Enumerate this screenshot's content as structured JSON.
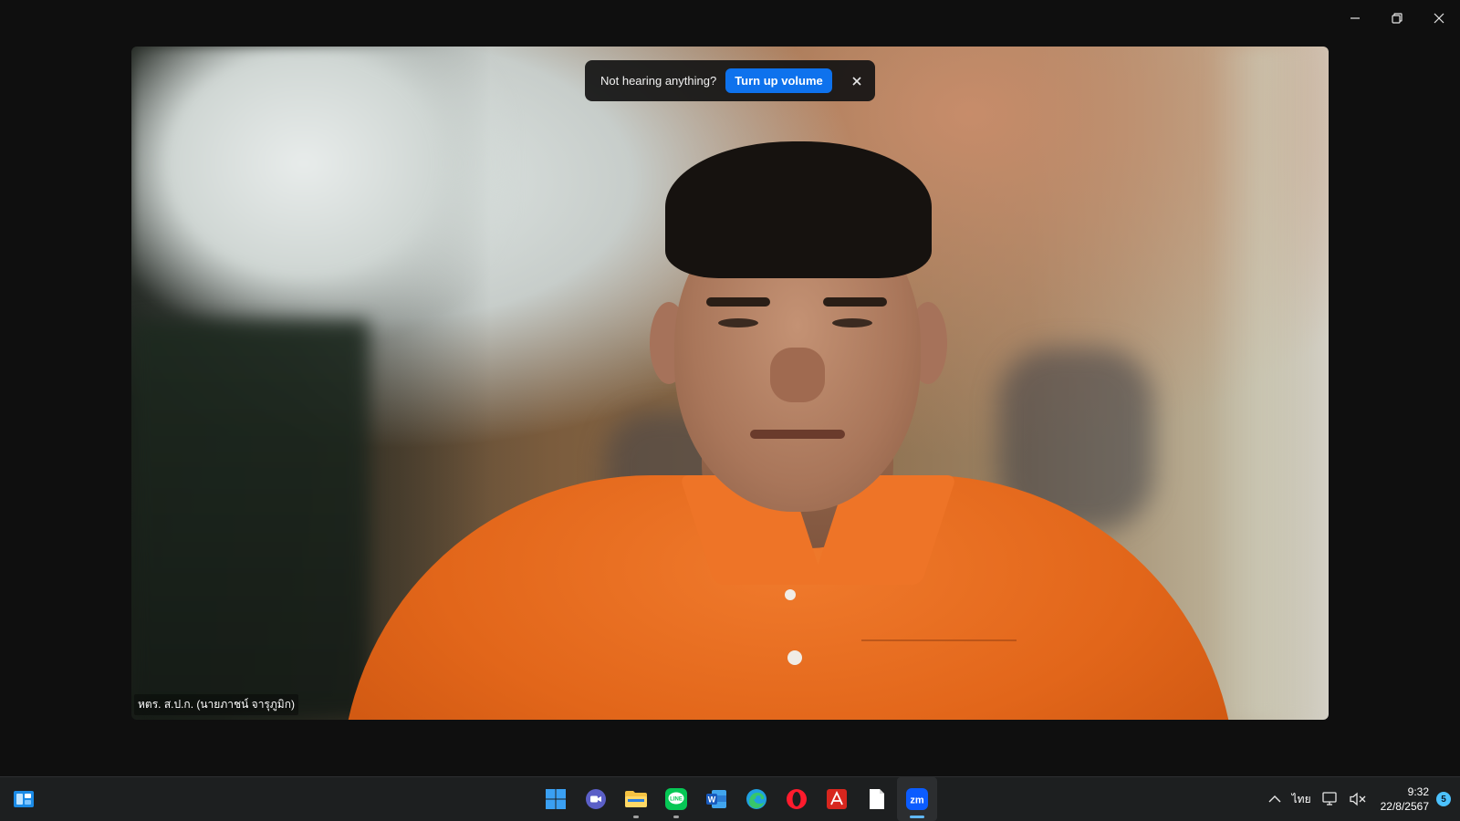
{
  "window": {
    "controls": [
      "minimize",
      "restore",
      "close"
    ]
  },
  "notice": {
    "text": "Not hearing anything?",
    "button_label": "Turn up volume",
    "close_symbol": "×",
    "button_color": "#0e72ed"
  },
  "participant": {
    "name": "หตร. ส.ป.ก. (นายภาชน์ จารุภูมิก)"
  },
  "taskbar": {
    "apps": [
      {
        "name": "start",
        "icon": "windows-start-icon",
        "running": false
      },
      {
        "name": "teams-meet",
        "icon": "video-chat-icon",
        "running": false
      },
      {
        "name": "file-explorer",
        "icon": "folder-icon",
        "running": true
      },
      {
        "name": "line",
        "icon": "line-chat-icon",
        "running": true
      },
      {
        "name": "word",
        "icon": "word-icon",
        "running": false
      },
      {
        "name": "edge",
        "icon": "edge-browser-icon",
        "running": false
      },
      {
        "name": "opera",
        "icon": "opera-browser-icon",
        "running": false
      },
      {
        "name": "acrobat",
        "icon": "acrobat-icon",
        "running": false
      },
      {
        "name": "notepad",
        "icon": "document-icon",
        "running": false
      },
      {
        "name": "zoom",
        "icon": "zoom-icon",
        "label": "zm",
        "running": true,
        "active": true
      }
    ],
    "tray": {
      "language": "ไทย",
      "time": "9:32",
      "date": "22/8/2567",
      "notification_count": "5"
    },
    "accent": "#60b8ff"
  }
}
